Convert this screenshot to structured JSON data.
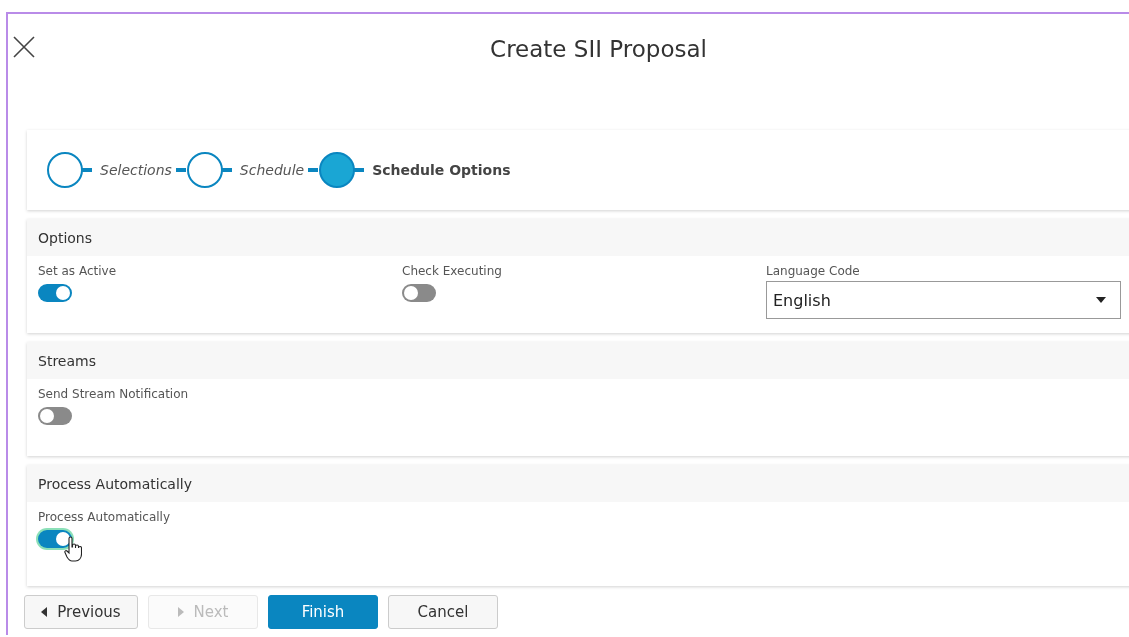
{
  "dialog": {
    "title": "Create SII Proposal"
  },
  "steps": [
    {
      "label": "Selections",
      "selected": false
    },
    {
      "label": "Schedule",
      "selected": false
    },
    {
      "label": "Schedule Options",
      "selected": true
    }
  ],
  "sections": [
    {
      "title": "Options",
      "fields": [
        {
          "kind": "toggle",
          "label": "Set as Active",
          "on": true,
          "focused": false
        },
        {
          "kind": "toggle",
          "label": "Check Executing",
          "on": false,
          "focused": false
        },
        {
          "kind": "select",
          "label": "Language Code",
          "value": "English"
        }
      ]
    },
    {
      "title": "Streams",
      "fields": [
        {
          "kind": "toggle",
          "label": "Send Stream Notification",
          "on": false,
          "focused": false
        }
      ]
    },
    {
      "title": "Process Automatically",
      "fields": [
        {
          "kind": "toggle",
          "label": "Process Automatically",
          "on": true,
          "focused": true
        }
      ]
    }
  ],
  "buttons": [
    {
      "kind": "previous",
      "label": "Previous",
      "disabled": false
    },
    {
      "kind": "next",
      "label": "Next",
      "disabled": true
    },
    {
      "kind": "primary",
      "label": "Finish",
      "disabled": false
    },
    {
      "kind": "plain",
      "label": "Cancel",
      "disabled": false
    }
  ]
}
